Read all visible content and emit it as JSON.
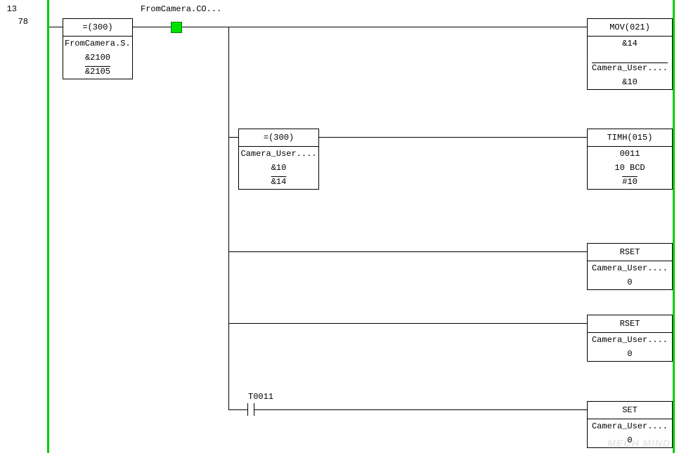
{
  "rung_number": "13",
  "step_number": "78",
  "top_contact_label": "FromCamera.CO...",
  "b2_contact_label": "T0011",
  "input_block": {
    "title": "=(300)",
    "row1": "FromCamera.S...",
    "row2": "&2100",
    "row3": "&2105"
  },
  "cmp_block": {
    "title": "=(300)",
    "row1": "Camera_User....",
    "row2": "&10",
    "row3": "&14"
  },
  "mov_block": {
    "title": "MOV(021)",
    "row1": "&14",
    "row2": "Camera_User....",
    "row3": "&10"
  },
  "timh_block": {
    "title": "TIMH(015)",
    "row1": "0011",
    "row2": "10 BCD",
    "row3": "#10"
  },
  "rset1_block": {
    "title": "RSET",
    "row1": "Camera_User....",
    "row2": "0"
  },
  "rset2_block": {
    "title": "RSET",
    "row1": "Camera_User....",
    "row2": "0"
  },
  "set_block": {
    "title": "SET",
    "row1": "Camera_User....",
    "row2": "0"
  },
  "watermark": "MECH MIND"
}
